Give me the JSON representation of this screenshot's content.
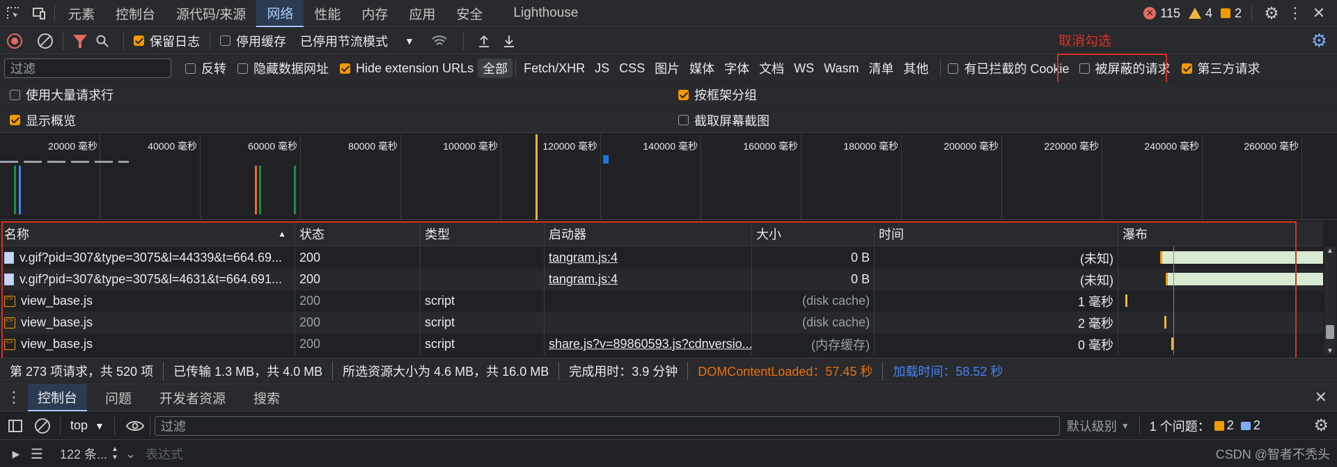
{
  "tabs": [
    "元素",
    "控制台",
    "源代码/来源",
    "网络",
    "性能",
    "内存",
    "应用",
    "安全",
    "Lighthouse"
  ],
  "badges": {
    "errors": "115",
    "warnings": "4",
    "issues": "2"
  },
  "toolbar": {
    "preserve_log": "保留日志",
    "disable_cache": "停用缓存",
    "throttle": "已停用节流模式"
  },
  "filter": {
    "placeholder": "过滤",
    "invert": "反转",
    "hide_data_urls": "隐藏数据网址",
    "hide_ext_urls": "Hide extension URLs",
    "types": [
      "全部",
      "Fetch/XHR",
      "JS",
      "CSS",
      "图片",
      "媒体",
      "字体",
      "文档",
      "WS",
      "Wasm",
      "清单",
      "其他"
    ],
    "blocked_cookies": "有已拦截的 Cookie",
    "blocked_requests": "被屏蔽的请求",
    "third_party": "第三方请求"
  },
  "annotation": "取消勾选",
  "settings": {
    "large_rows": "使用大量请求行",
    "group_by_frame": "按框架分组",
    "show_overview": "显示概览",
    "screenshots": "截取屏幕截图"
  },
  "overview_ticks": [
    "20000 毫秒",
    "40000 毫秒",
    "60000 毫秒",
    "80000 毫秒",
    "100000 毫秒",
    "120000 毫秒",
    "140000 毫秒",
    "160000 毫秒",
    "180000 毫秒",
    "200000 毫秒",
    "220000 毫秒",
    "240000 毫秒",
    "260000 毫秒"
  ],
  "columns": {
    "name": "名称",
    "status": "状态",
    "type": "类型",
    "initiator": "启动器",
    "size": "大小",
    "time": "时间",
    "waterfall": "瀑布"
  },
  "rows": [
    {
      "name": "v.gif?pid=307&type=3075&l=44339&t=664.69...",
      "status": "200",
      "type": "",
      "initiator": "tangram.js:4",
      "size": "0 B",
      "time": "(未知)"
    },
    {
      "name": "v.gif?pid=307&type=3075&l=4631&t=664.691...",
      "status": "200",
      "type": "",
      "initiator": "tangram.js:4",
      "size": "0 B",
      "time": "(未知)"
    },
    {
      "name": "view_base.js",
      "status": "200",
      "type": "script",
      "initiator": "",
      "size": "(disk cache)",
      "time": "1 毫秒"
    },
    {
      "name": "view_base.js",
      "status": "200",
      "type": "script",
      "initiator": "",
      "size": "(disk cache)",
      "time": "2 毫秒"
    },
    {
      "name": "view_base.js",
      "status": "200",
      "type": "script",
      "initiator": "share.js?v=89860593.js?cdnversio...",
      "size": "(内存缓存)",
      "time": "0 毫秒"
    }
  ],
  "status_bar": {
    "requests": "第 273 项请求，共 520 项",
    "transferred": "已传输 1.3 MB，共 4.0 MB",
    "resources": "所选资源大小为 4.6 MB，共 16.0 MB",
    "finish": "完成用时：3.9 分钟",
    "dcl": "DOMContentLoaded：57.45 秒",
    "load": "加载时间：58.52 秒"
  },
  "drawer_tabs": [
    "控制台",
    "问题",
    "开发者资源",
    "搜索"
  ],
  "console": {
    "context": "top",
    "filter_placeholder": "过滤",
    "level": "默认级别",
    "issues_label": "1 个问题：",
    "issue_warn": "2",
    "issue_info": "2",
    "messages": "122 条...",
    "expression": "表达式"
  },
  "watermark": "CSDN @智者不秃头",
  "colors": {
    "accent": "#a8c7fa",
    "error": "#e46962",
    "warning": "#f29900",
    "annotation": "#d93025",
    "dcl": "#e8710a",
    "load": "#4285f4"
  }
}
